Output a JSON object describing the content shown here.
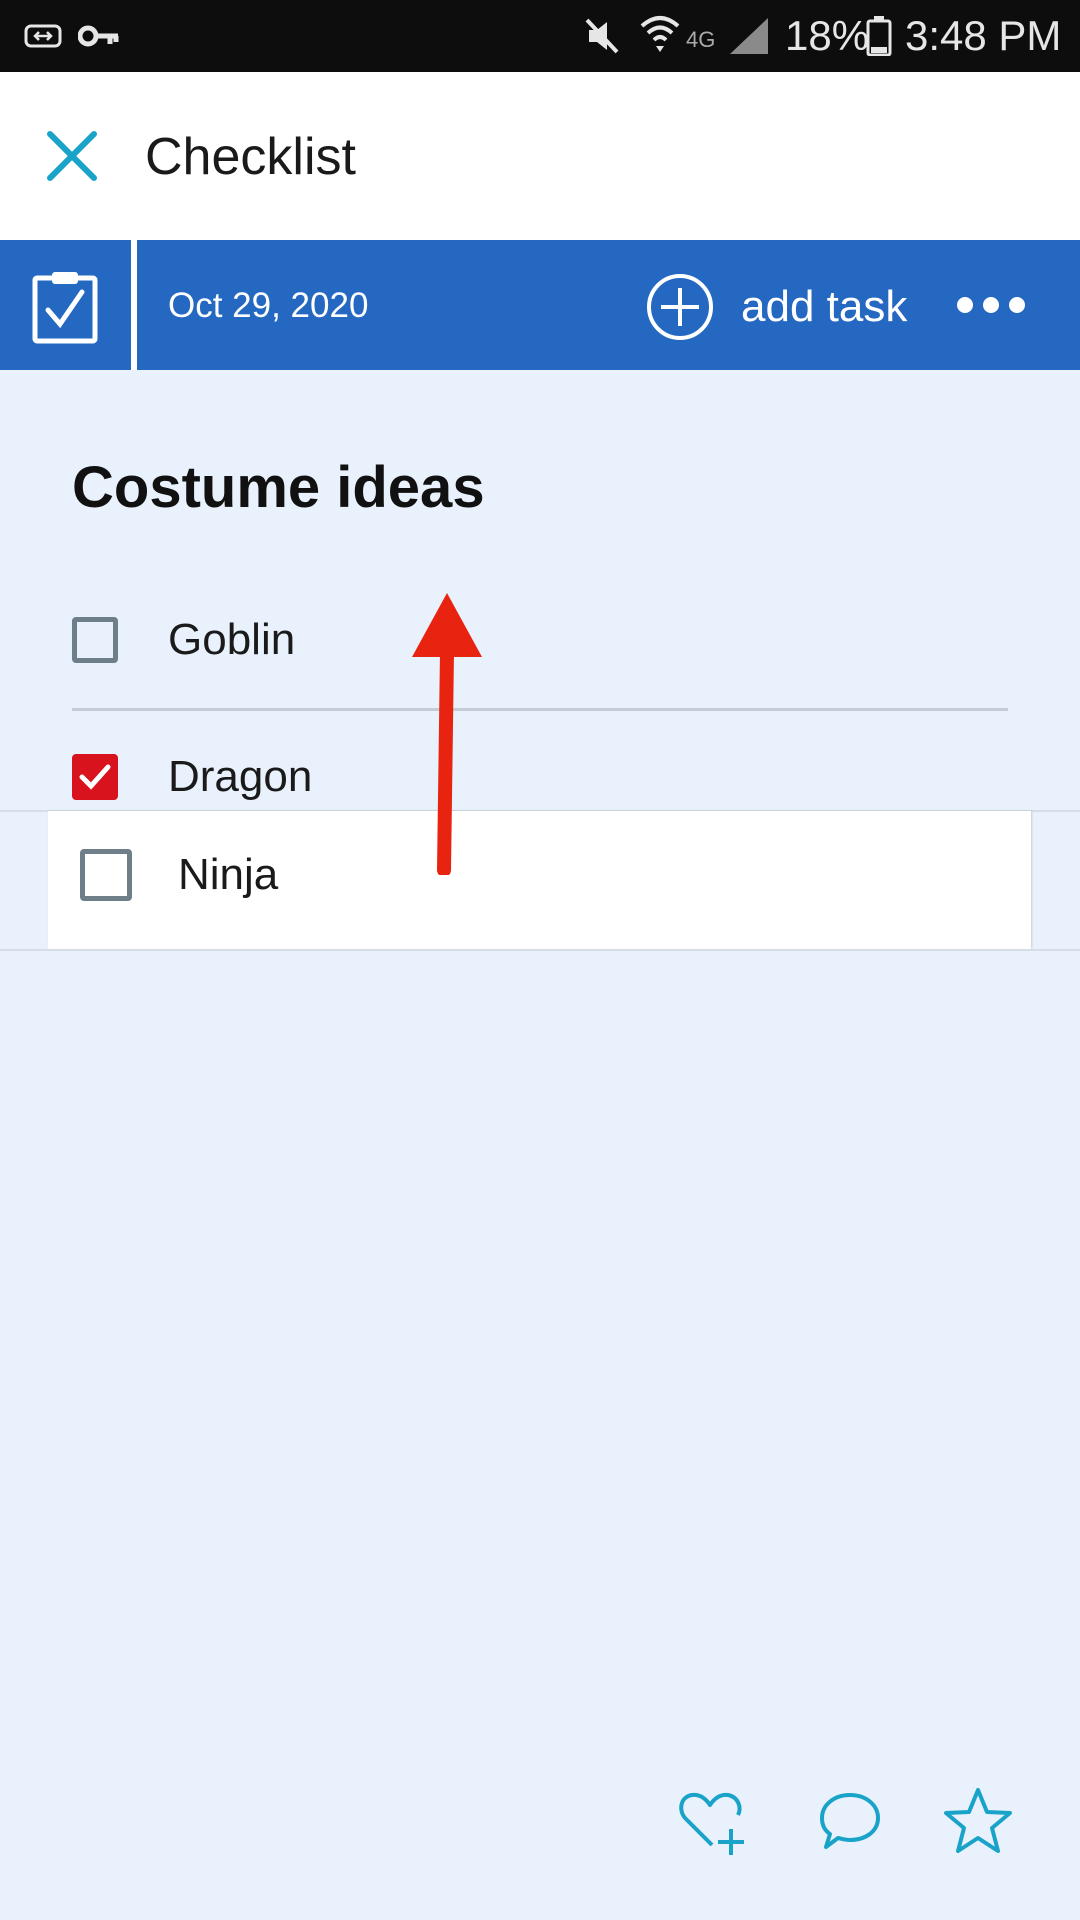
{
  "status_bar": {
    "battery_percent": "18%",
    "time": "3:48 PM",
    "network_label": "4G"
  },
  "header": {
    "title": "Checklist",
    "close_icon": "close-icon"
  },
  "toolbar": {
    "date": "Oct 29, 2020",
    "add_task_label": "add task",
    "more_icon": "more-horizontal-icon",
    "checklist_icon": "clipboard-check-icon"
  },
  "list": {
    "title": "Costume ideas",
    "tasks": [
      {
        "label": "Goblin",
        "checked": false
      },
      {
        "label": "Dragon",
        "checked": true
      },
      {
        "label": "Ninja",
        "checked": false,
        "dragging": true
      }
    ]
  },
  "bottom_actions": {
    "like_icon": "heart-plus-icon",
    "comment_icon": "comment-icon",
    "favorite_icon": "star-icon"
  },
  "colors": {
    "toolbar_blue": "#2468c2",
    "accent_teal": "#1aa3c8",
    "check_red": "#d9131e",
    "background": "#e8f1fc"
  }
}
